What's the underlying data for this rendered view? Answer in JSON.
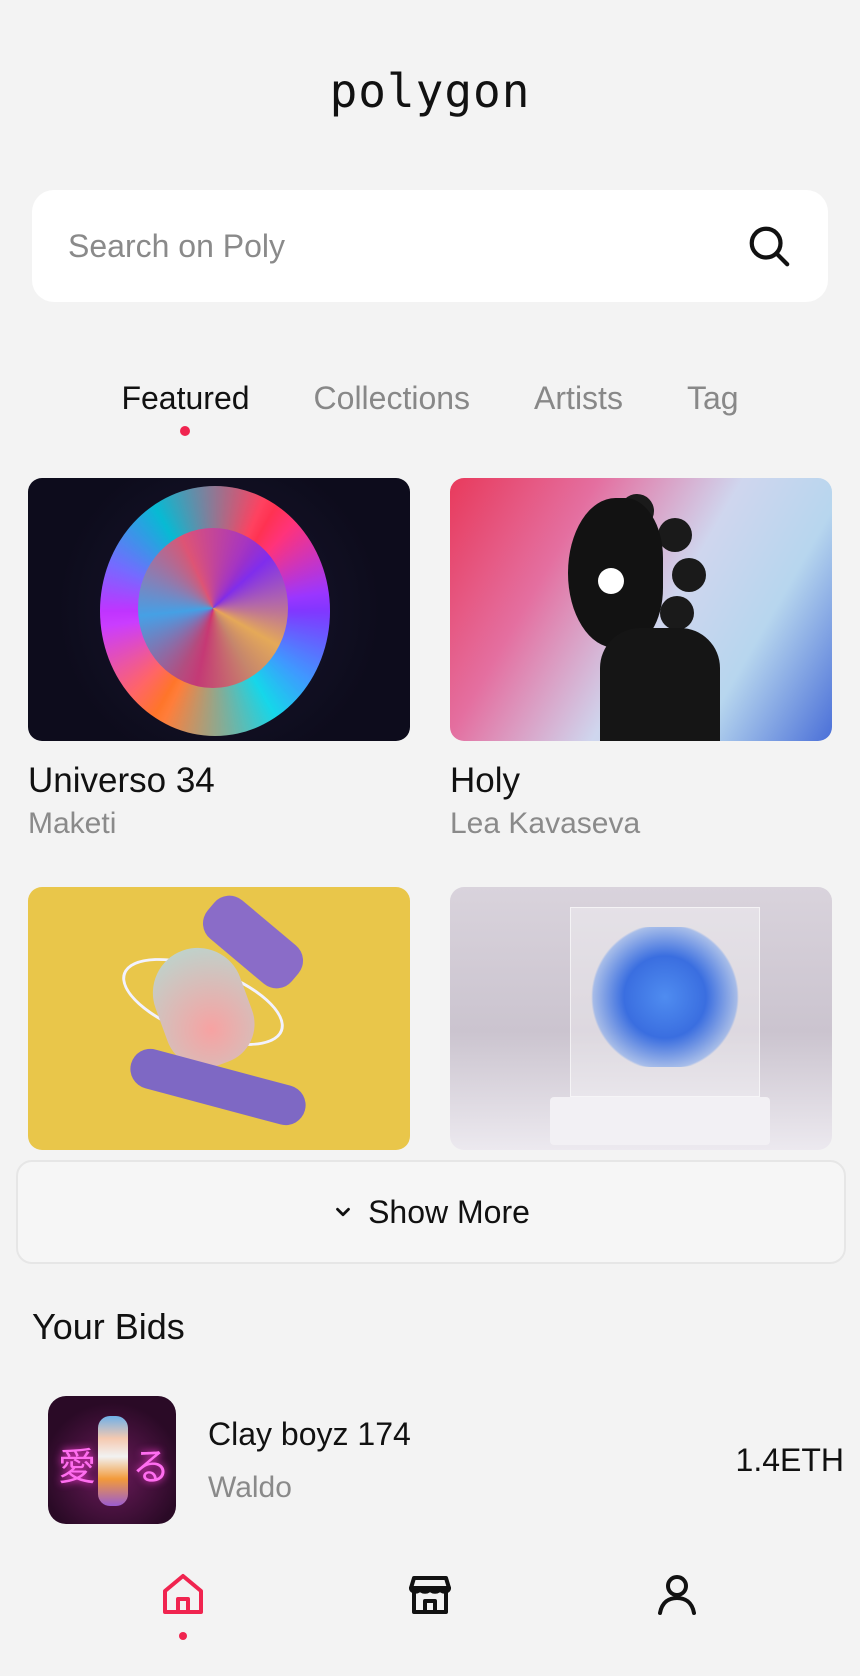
{
  "app": {
    "logo": "polygon"
  },
  "search": {
    "placeholder": "Search on Poly"
  },
  "tabs": [
    {
      "label": "Featured",
      "active": true
    },
    {
      "label": "Collections",
      "active": false
    },
    {
      "label": "Artists",
      "active": false
    },
    {
      "label": "Tag",
      "active": false
    }
  ],
  "cards": [
    {
      "title": "Universo 34",
      "artist": "Maketi"
    },
    {
      "title": "Holy",
      "artist": "Lea Kavaseva"
    },
    {
      "title": "",
      "artist": ""
    },
    {
      "title": "",
      "artist": ""
    }
  ],
  "show_more": {
    "label": "Show More"
  },
  "bids": {
    "title": "Your Bids",
    "items": [
      {
        "name": "Clay boyz 174",
        "artist": "Waldo",
        "price": "1.4ETH",
        "thumb_text_left": "愛",
        "thumb_text_right": "る"
      }
    ]
  },
  "nav": {
    "items": [
      {
        "icon": "home-icon",
        "active": true
      },
      {
        "icon": "store-icon",
        "active": false
      },
      {
        "icon": "profile-icon",
        "active": false
      }
    ]
  },
  "colors": {
    "accent": "#f0244f",
    "background": "#f3f3f3",
    "muted_text": "#8a8a8a"
  }
}
